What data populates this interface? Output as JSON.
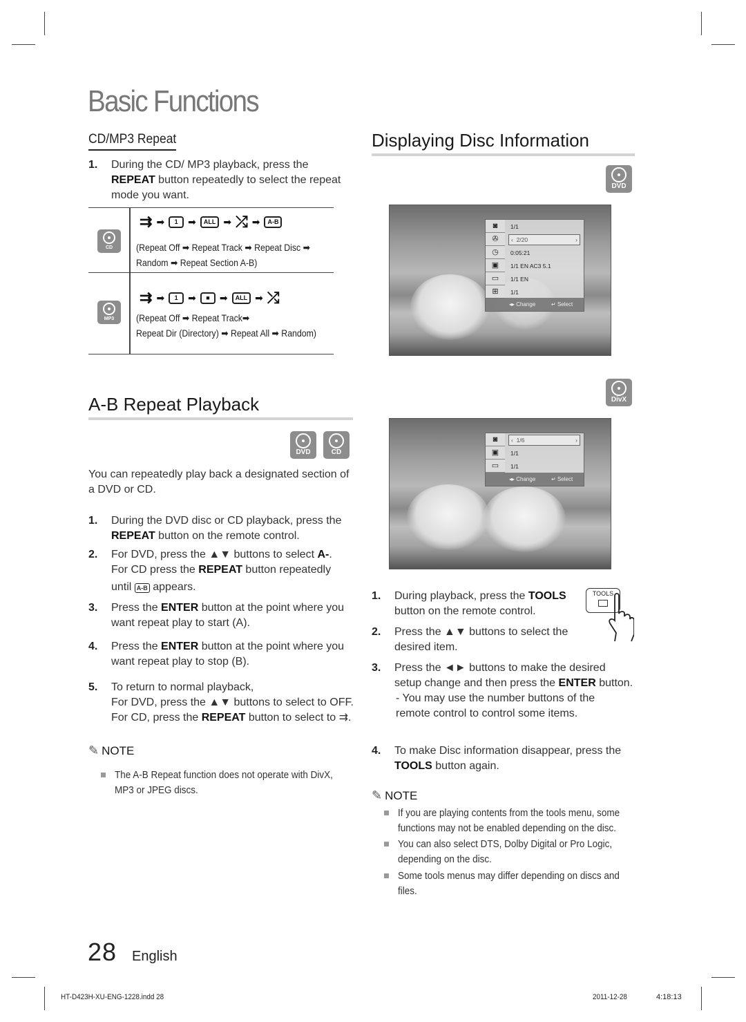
{
  "page": {
    "title": "Basic Functions",
    "page_number": "28",
    "language": "English",
    "footer_file": "HT-D423H-XU-ENG-1228.indd   28",
    "footer_date": "2011-12-28",
    "footer_time": "4:18:13"
  },
  "cd_mp3_repeat": {
    "heading": "CD/MP3 Repeat",
    "step1_num": "1.",
    "step1_pre": "During the CD/ MP3 playback, press the ",
    "step1_bold": "REPEAT",
    "step1_post": " button repeatedly to select the repeat mode you want.",
    "rows": [
      {
        "badge": "CD",
        "sequence": [
          {
            "icon": "repeat-off-icon",
            "text": "⇉"
          },
          {
            "icon": "repeat-track-icon",
            "text": "1"
          },
          {
            "icon": "repeat-disc-icon",
            "text": "ALL"
          },
          {
            "icon": "random-icon",
            "text": "⤮"
          },
          {
            "icon": "repeat-ab-icon",
            "text": "A-B"
          }
        ],
        "description_line1": "(Repeat Off ➡ Repeat Track ➡ Repeat Disc ➡",
        "description_line2": "Random ➡ Repeat Section A-B)"
      },
      {
        "badge": "MP3",
        "sequence": [
          {
            "icon": "repeat-off-icon",
            "text": "⇉"
          },
          {
            "icon": "repeat-track-icon",
            "text": "1"
          },
          {
            "icon": "repeat-folder-icon",
            "text": "■"
          },
          {
            "icon": "repeat-all-icon",
            "text": "ALL"
          },
          {
            "icon": "random-icon",
            "text": "⤮"
          }
        ],
        "description_line1": "(Repeat Off ➡ Repeat Track➡",
        "description_line2": "Repeat Dir (Directory) ➡ Repeat All ➡ Random)"
      }
    ],
    "arrow": "➡"
  },
  "ab_repeat": {
    "heading": "A-B Repeat Playback",
    "badges": [
      "DVD",
      "CD"
    ],
    "intro": "You can repeatedly play back a designated section of a DVD or CD.",
    "steps": [
      {
        "num": "1.",
        "pre": "During the DVD disc or CD playback, press the ",
        "bold": "REPEAT",
        "post": " button on the remote control."
      },
      {
        "num": "2.",
        "pre": "For DVD, press the ▲▼ buttons to select ",
        "bold": "A-",
        "post": ".",
        "line2_pre": "For CD press the ",
        "line2_bold": "REPEAT",
        "line2_post": " button repeatedly",
        "line3_pre": "until ",
        "line3_icon": "A-B",
        "line3_post": " appears."
      },
      {
        "num": "3.",
        "pre": "Press the ",
        "bold": "ENTER",
        "post": " button at the point where you want repeat play to start (A)."
      },
      {
        "num": "4.",
        "pre": "Press the ",
        "bold": "ENTER",
        "post": " button at the point where you want repeat play to stop (B)."
      },
      {
        "num": "5.",
        "line1": "To return to normal playback,",
        "line2": "For DVD, press the ▲▼ buttons to select to OFF.",
        "line3_pre": "For CD, press the ",
        "line3_bold": "REPEAT",
        "line3_post": " button to select to ⇉."
      }
    ],
    "note_label": "NOTE",
    "notes": [
      "The A-B Repeat function does not operate with DivX, MP3 or JPEG discs."
    ]
  },
  "disc_info": {
    "heading": "Displaying Disc Information",
    "dvd_badge": "DVD",
    "divx_badge": "DivX",
    "dvd_osd": {
      "rows": [
        {
          "icon": "title-icon",
          "value": "1/1"
        },
        {
          "icon": "chapter-icon",
          "value": "2/20",
          "selected": true
        },
        {
          "icon": "time-icon",
          "value": "0:05:21"
        },
        {
          "icon": "audio-icon",
          "value": "1/1 EN AC3 5.1"
        },
        {
          "icon": "subtitle-icon",
          "value": "1/1 EN"
        },
        {
          "icon": "angle-icon",
          "value": "1/1"
        }
      ],
      "change_label": "◂▸ Change",
      "select_label": "Select"
    },
    "divx_osd": {
      "rows": [
        {
          "icon": "title-icon",
          "value": "1/6",
          "selected": true
        },
        {
          "icon": "audio-icon",
          "value": "1/1"
        },
        {
          "icon": "subtitle-icon",
          "value": "1/1"
        }
      ],
      "change_label": "◂▸ Change",
      "select_label": "Select"
    },
    "tools_button_label": "TOOLS",
    "steps": [
      {
        "num": "1.",
        "pre": "During playback, press the ",
        "bold": "TOOLS",
        "post": " button on the remote control."
      },
      {
        "num": "2.",
        "text": "Press the ▲▼ buttons to select the desired item."
      },
      {
        "num": "3.",
        "pre": "Press the ◄► buttons to make the desired setup change and then press the ",
        "bold": "ENTER",
        "post": " button.",
        "sub": "- You may use the number buttons of the remote control to control some items."
      },
      {
        "num": "4.",
        "pre": "To make Disc information disappear, press the ",
        "bold": "TOOLS",
        "post": " button again."
      }
    ],
    "note_label": "NOTE",
    "notes": [
      "If you are playing contents from the tools menu, some functions may not be enabled depending on the disc.",
      "You can also select DTS, Dolby Digital or Pro Logic, depending on the disc.",
      "Some tools menus may differ depending on discs and files."
    ]
  }
}
